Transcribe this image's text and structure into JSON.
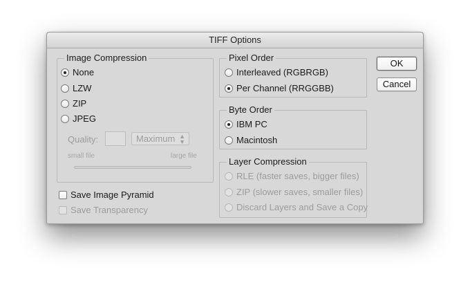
{
  "dialog": {
    "title": "TIFF Options"
  },
  "image_compression": {
    "legend": "Image Compression",
    "options": [
      {
        "label": "None",
        "selected": true
      },
      {
        "label": "LZW",
        "selected": false
      },
      {
        "label": "ZIP",
        "selected": false
      },
      {
        "label": "JPEG",
        "selected": false
      }
    ],
    "quality_label": "Quality:",
    "quality_value": "",
    "quality_preset": "Maximum",
    "slider_min_label": "small file",
    "slider_max_label": "large file"
  },
  "pixel_order": {
    "legend": "Pixel Order",
    "options": [
      {
        "label": "Interleaved (RGBRGB)",
        "selected": false
      },
      {
        "label": "Per Channel (RRGGBB)",
        "selected": true
      }
    ]
  },
  "byte_order": {
    "legend": "Byte Order",
    "options": [
      {
        "label": "IBM PC",
        "selected": true
      },
      {
        "label": "Macintosh",
        "selected": false
      }
    ]
  },
  "layer_compression": {
    "legend": "Layer Compression",
    "enabled": false,
    "options": [
      {
        "label": "RLE (faster saves, bigger files)",
        "selected": false
      },
      {
        "label": "ZIP (slower saves, smaller files)",
        "selected": false
      },
      {
        "label": "Discard Layers and Save a Copy",
        "selected": false
      }
    ]
  },
  "checkboxes": {
    "save_image_pyramid": {
      "label": "Save Image Pyramid",
      "checked": false,
      "enabled": true
    },
    "save_transparency": {
      "label": "Save Transparency",
      "checked": false,
      "enabled": false
    }
  },
  "buttons": {
    "ok": "OK",
    "cancel": "Cancel"
  }
}
